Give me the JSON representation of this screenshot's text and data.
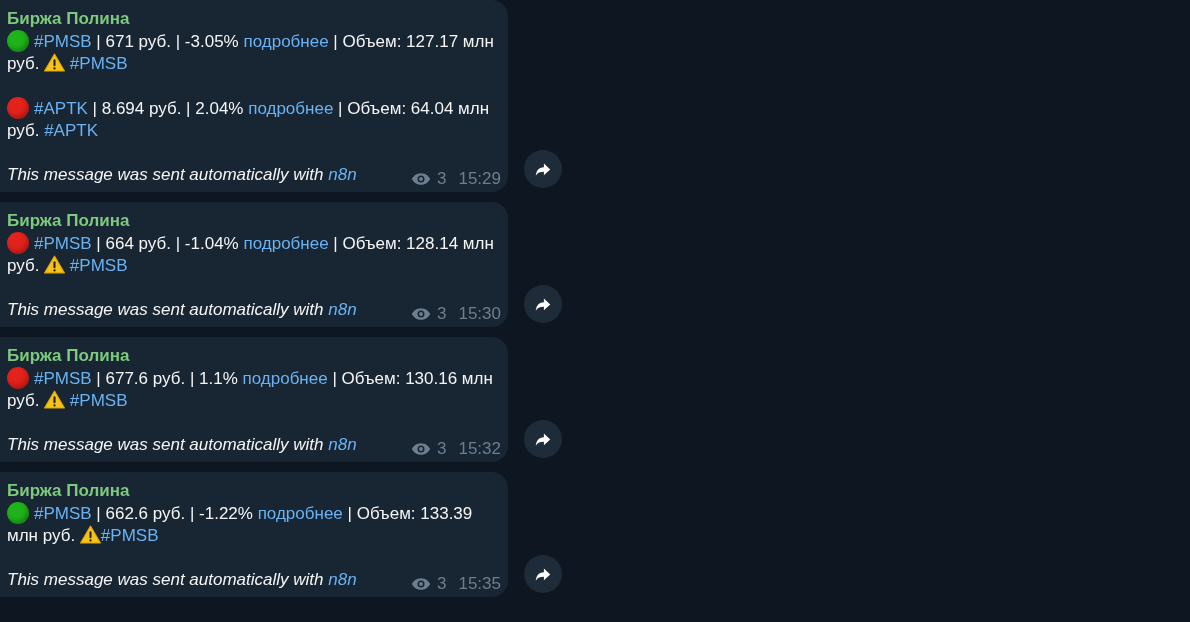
{
  "messages": [
    {
      "sender": "Биржа Полина",
      "entries": [
        [
          {
            "kind": "dot",
            "color": "#1fb31a"
          },
          {
            "kind": "tag",
            "text": "#PMSB"
          },
          {
            "kind": "text",
            "text": " | 671 руб. | -3.05% "
          },
          {
            "kind": "link",
            "text": "подробнее"
          },
          {
            "kind": "text",
            "text": " | Объем: 127.17 млн руб. "
          },
          {
            "kind": "warning"
          },
          {
            "kind": "tag",
            "text": " #PMSB"
          }
        ],
        [
          {
            "kind": "dot",
            "color": "#e3221c"
          },
          {
            "kind": "tag",
            "text": "#APTK"
          },
          {
            "kind": "text",
            "text": " | 8.694 руб. | 2.04% "
          },
          {
            "kind": "link",
            "text": "подробнее"
          },
          {
            "kind": "text",
            "text": " | Объем: 64.04 млн руб. "
          },
          {
            "kind": "tag",
            "text": "#APTK"
          }
        ]
      ],
      "footer": "This message was sent automatically with",
      "footer_link": "n8n",
      "views": "3",
      "time": "15:29"
    },
    {
      "sender": "Биржа Полина",
      "entries": [
        [
          {
            "kind": "dot",
            "color": "#e3221c"
          },
          {
            "kind": "tag",
            "text": "#PMSB"
          },
          {
            "kind": "text",
            "text": " | 664 руб. | -1.04% "
          },
          {
            "kind": "link",
            "text": "подробнее"
          },
          {
            "kind": "text",
            "text": " | Объем: 128.14 млн руб. "
          },
          {
            "kind": "warning"
          },
          {
            "kind": "tag",
            "text": " #PMSB"
          }
        ]
      ],
      "footer": "This message was sent automatically with",
      "footer_link": "n8n",
      "views": "3",
      "time": "15:30"
    },
    {
      "sender": "Биржа Полина",
      "entries": [
        [
          {
            "kind": "dot",
            "color": "#e3221c"
          },
          {
            "kind": "tag",
            "text": "#PMSB"
          },
          {
            "kind": "text",
            "text": " | 677.6 руб. | 1.1% "
          },
          {
            "kind": "link",
            "text": "подробнее"
          },
          {
            "kind": "text",
            "text": " | Объем: 130.16 млн руб. "
          },
          {
            "kind": "warning"
          },
          {
            "kind": "tag",
            "text": " #PMSB"
          }
        ]
      ],
      "footer": "This message was sent automatically with",
      "footer_link": "n8n",
      "views": "3",
      "time": "15:32"
    },
    {
      "sender": "Биржа Полина",
      "entries": [
        [
          {
            "kind": "dot",
            "color": "#1fb31a"
          },
          {
            "kind": "tag",
            "text": "#PMSB"
          },
          {
            "kind": "text",
            "text": " | 662.6 руб. | -1.22% "
          },
          {
            "kind": "link",
            "text": "подробнее"
          },
          {
            "kind": "text",
            "text": " | Объем: 133.39 млн руб. "
          },
          {
            "kind": "warning"
          },
          {
            "kind": "tag",
            "text": "#PMSB"
          }
        ]
      ],
      "footer": "This message was sent automatically with",
      "footer_link": "n8n",
      "views": "3",
      "time": "15:35"
    }
  ]
}
